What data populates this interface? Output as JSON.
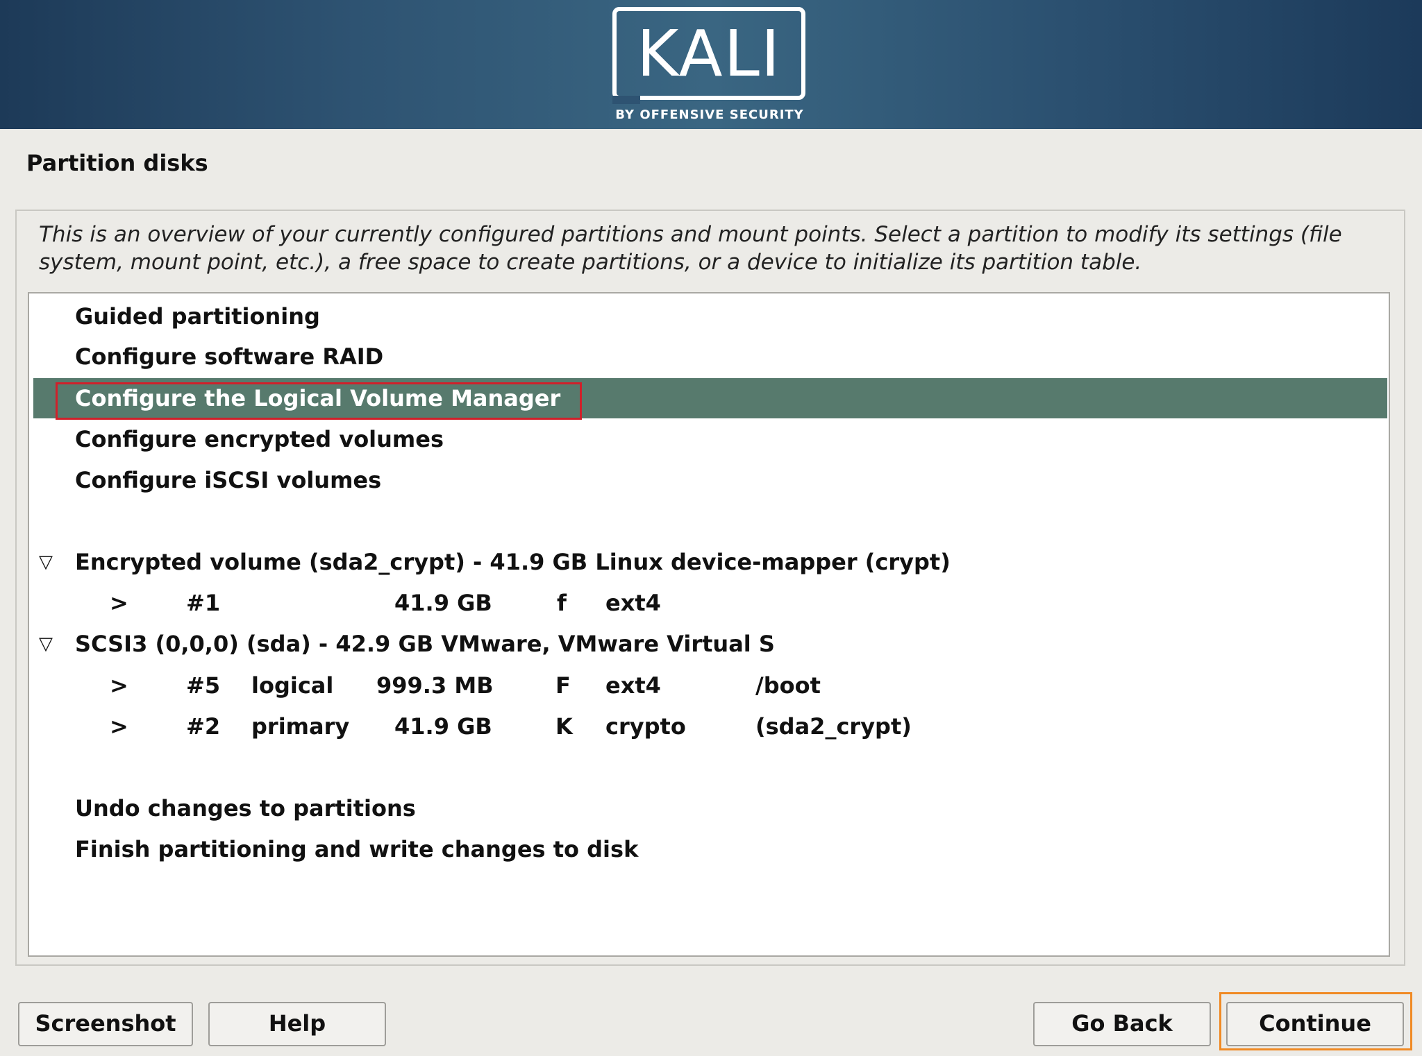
{
  "banner": {
    "logo_text": "KALI",
    "logo_subtitle": "BY OFFENSIVE SECURITY"
  },
  "page_title": "Partition disks",
  "description": "This is an overview of your currently configured partitions and mount points. Select a partition to modify its settings (file system, mount point, etc.), a free space to create partitions, or a device to initialize its partition table.",
  "menu": {
    "guided": "Guided partitioning",
    "raid": "Configure software RAID",
    "lvm": "Configure the Logical Volume Manager",
    "encrypted": "Configure encrypted volumes",
    "iscsi": "Configure iSCSI volumes",
    "undo": "Undo changes to partitions",
    "finish": "Finish partitioning and write changes to disk"
  },
  "devices": [
    {
      "expander": "▽",
      "label": "Encrypted volume (sda2_crypt) - 41.9 GB Linux device-mapper (crypt)",
      "partitions": [
        {
          "arrow": ">",
          "num": "#1",
          "type": "",
          "size": "41.9 GB",
          "flag": "f",
          "fs": "ext4",
          "mount": ""
        }
      ]
    },
    {
      "expander": "▽",
      "label": "SCSI3 (0,0,0) (sda) - 42.9 GB VMware, VMware Virtual S",
      "partitions": [
        {
          "arrow": ">",
          "num": "#5",
          "type": "logical",
          "size": "999.3 MB",
          "flag": "F",
          "fs": "ext4",
          "mount": "/boot"
        },
        {
          "arrow": ">",
          "num": "#2",
          "type": "primary",
          "size": "41.9 GB",
          "flag": "K",
          "fs": "crypto",
          "mount": "(sda2_crypt)"
        }
      ]
    }
  ],
  "buttons": {
    "screenshot": "Screenshot",
    "help": "Help",
    "go_back": "Go Back",
    "continue": "Continue"
  },
  "colors": {
    "selected_row": "#577a6d",
    "annotation_red": "#d0202a",
    "annotation_orange": "#f08a24"
  }
}
